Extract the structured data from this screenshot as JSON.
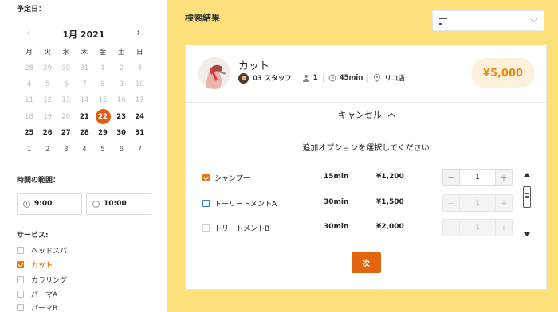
{
  "sidebar": {
    "date_label": "予定日：",
    "calendar": {
      "month_label": "1月 2021",
      "weekdays": [
        "月",
        "火",
        "水",
        "木",
        "金",
        "土",
        "日"
      ],
      "weeks": [
        [
          "28",
          "29",
          "30",
          "31",
          "1",
          "2",
          "3"
        ],
        [
          "4",
          "5",
          "6",
          "7",
          "8",
          "9",
          "10"
        ],
        [
          "11",
          "12",
          "13",
          "14",
          "15",
          "16",
          "17"
        ],
        [
          "18",
          "19",
          "20",
          "21",
          "22",
          "23",
          "24"
        ],
        [
          "25",
          "26",
          "27",
          "28",
          "29",
          "30",
          "31"
        ],
        [
          "1",
          "2",
          "3",
          "4",
          "5",
          "6",
          "7"
        ]
      ],
      "selected": "22"
    },
    "time_label": "時間の範囲：",
    "time_from": "9:00",
    "time_to": "10:00",
    "services_label": "サービス:",
    "services": [
      {
        "label": "ヘッドスパ",
        "checked": false
      },
      {
        "label": "カット",
        "checked": true
      },
      {
        "label": "カラリング",
        "checked": false
      },
      {
        "label": "パーマA",
        "checked": false
      },
      {
        "label": "パーマB",
        "checked": false
      }
    ]
  },
  "main": {
    "title": "検索結果",
    "sort_select_value": "",
    "card": {
      "service_name": "カット",
      "staff": "03 スタッフ",
      "count": "1",
      "duration": "45min",
      "location": "リコ店",
      "price": "¥5,000",
      "cancel_label": "キャンセル",
      "options_heading": "追加オプションを選択してください",
      "options": [
        {
          "name": "シャンプー",
          "duration": "15min",
          "price": "¥1,200",
          "qty": "1",
          "checked": true,
          "enabled": true
        },
        {
          "name": "トーリートメントA",
          "duration": "30min",
          "price": "¥1,500",
          "qty": "1",
          "checked": false,
          "enabled": false
        },
        {
          "name": "トリートメントB",
          "duration": "30min",
          "price": "¥2,000",
          "qty": "1",
          "checked": false,
          "enabled": false
        }
      ],
      "next_label": "次"
    }
  },
  "colors": {
    "background": "#fbe07c",
    "accent": "#e3650f",
    "price_text": "#ef8a12",
    "price_bg": "#fdf1dc",
    "focus": "#2f7bd8"
  },
  "icons": {
    "prev_month": "chevron-left-icon",
    "next_month": "chevron-right-icon",
    "clock": "clock-icon",
    "sort": "sort-icon",
    "dropdown": "chevron-down-icon",
    "person": "person-icon",
    "time": "clock-icon",
    "location": "location-pin-icon",
    "collapse": "chevron-up-icon"
  }
}
